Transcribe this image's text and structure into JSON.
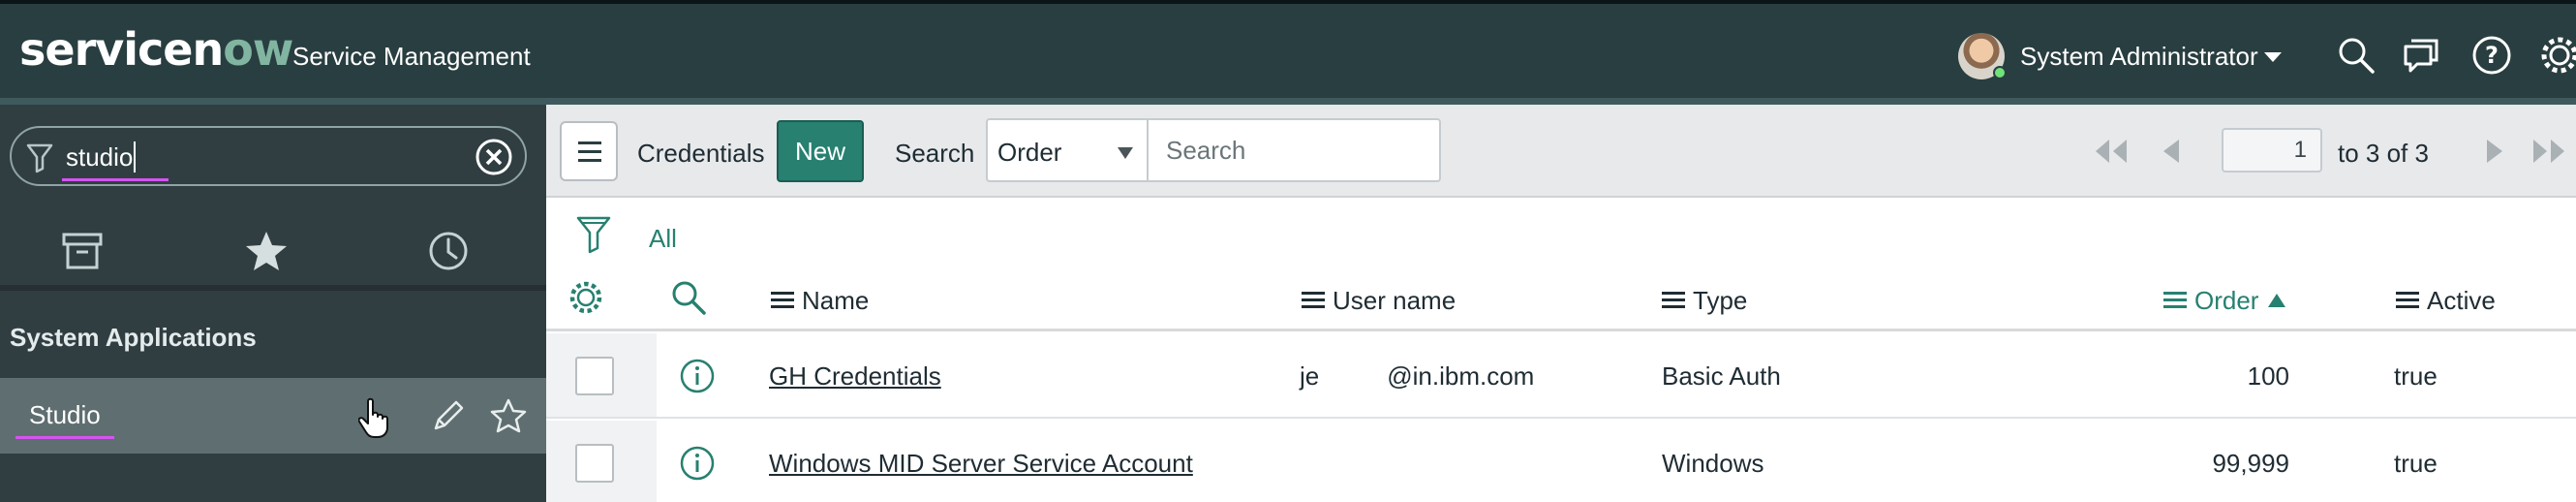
{
  "banner": {
    "logo": "servicenow",
    "product": "Service Management",
    "user_name": "System Administrator",
    "icons": [
      "search-icon",
      "chat-icon",
      "help-icon",
      "gear-icon"
    ],
    "accent": "#293e40"
  },
  "nav": {
    "filter_value": "studio",
    "tabs": [
      "all-applications-icon",
      "favorites-icon",
      "history-icon"
    ],
    "section_title": "System Applications",
    "item_label": "Studio"
  },
  "list": {
    "title": "Credentials",
    "new_label": "New",
    "search_label": "Search",
    "search_field": "Order",
    "search_placeholder": "Search",
    "page_value": "1",
    "page_total": "to 3 of 3",
    "breadcrumb_all": "All",
    "columns": [
      "Name",
      "User name",
      "Type",
      "Order",
      "Active"
    ],
    "sort_column": "Order",
    "rows": [
      {
        "name": "GH Credentials",
        "user_prefix": "je",
        "user_suffix": "@in.ibm.com",
        "type": "Basic Auth",
        "order": "100",
        "active": "true"
      },
      {
        "name": "Windows MID Server Service Account",
        "user_prefix": "",
        "user_suffix": "",
        "type": "Windows",
        "order": "99,999",
        "active": "true"
      }
    ]
  },
  "colors": {
    "brand_green": "#278070",
    "highlight": "#d454ef",
    "nav_bg": "#303e42"
  }
}
